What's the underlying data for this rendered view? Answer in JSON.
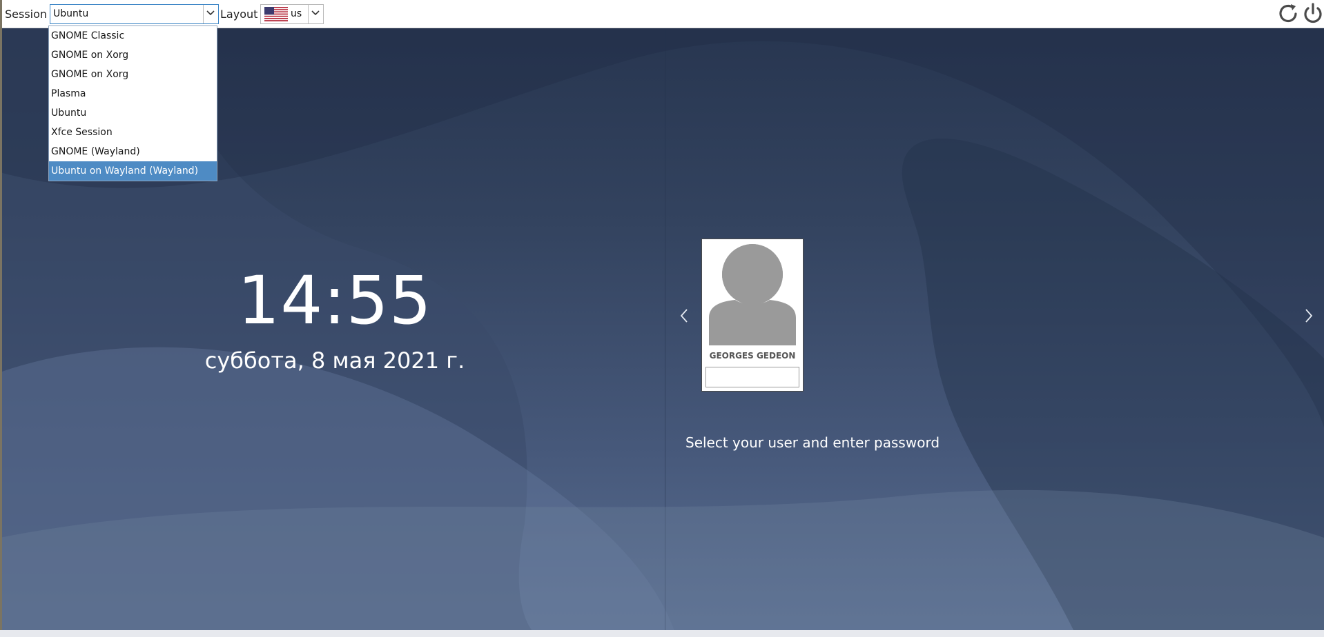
{
  "topbar": {
    "session_label": "Session",
    "session_value": "Ubuntu",
    "layout_label": "Layout",
    "layout_value": "us",
    "layout_flag_icon": "us-flag-icon"
  },
  "session_options": [
    {
      "label": "GNOME Classic",
      "selected": false
    },
    {
      "label": "GNOME on Xorg",
      "selected": false
    },
    {
      "label": "GNOME on Xorg",
      "selected": false
    },
    {
      "label": "Plasma",
      "selected": false
    },
    {
      "label": "Ubuntu",
      "selected": false
    },
    {
      "label": "Xfce Session",
      "selected": false
    },
    {
      "label": "GNOME (Wayland)",
      "selected": false
    },
    {
      "label": "Ubuntu on Wayland (Wayland)",
      "selected": true
    }
  ],
  "clock": {
    "time": "14:55",
    "date": "суббота, 8 мая 2021 г."
  },
  "user": {
    "name": "GEORGES GEDEON",
    "password_value": ""
  },
  "hint": "Select your user and enter password",
  "icons": {
    "reboot": "reboot-icon",
    "power": "power-icon",
    "prev": "chevron-left-icon",
    "next": "chevron-right-icon",
    "avatar": "user-avatar-icon"
  },
  "colors": {
    "selection": "#4e8bc4",
    "focus_border": "#3d86c6",
    "background_dark": "#26344e",
    "background_light": "#5b6f92"
  }
}
